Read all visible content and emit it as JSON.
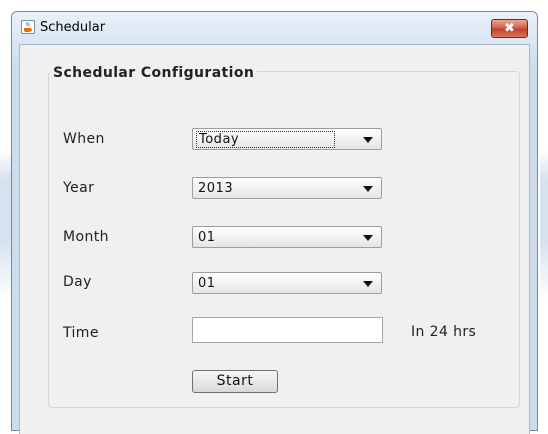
{
  "window": {
    "title": "Schedular",
    "close_label": "✖"
  },
  "group": {
    "legend": "Schedular Configuration"
  },
  "fields": {
    "when": {
      "label": "When",
      "value": "Today"
    },
    "year": {
      "label": "Year",
      "value": "2013"
    },
    "month": {
      "label": "Month",
      "value": "01"
    },
    "day": {
      "label": "Day",
      "value": "01"
    },
    "time": {
      "label": "Time",
      "value": "",
      "hint": "In 24 hrs"
    }
  },
  "buttons": {
    "start_label": "Start"
  },
  "icons": {
    "app": "java-cup-icon",
    "close": "close-icon",
    "dropdown": "chevron-down-icon"
  },
  "colors": {
    "close_button": "#c2402a",
    "title_bar": "#d9e6f3",
    "client_bg": "#f0f0f0"
  }
}
